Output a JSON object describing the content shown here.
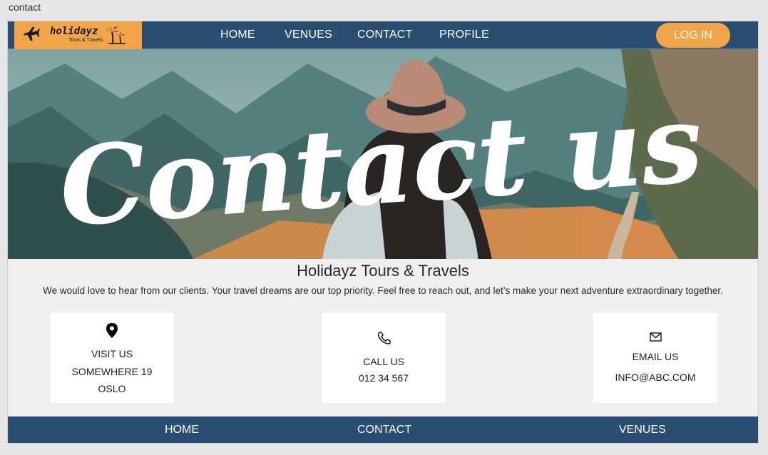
{
  "page_label": "contact",
  "header": {
    "logo_title": "holidayz",
    "logo_subtitle": "Tours & Travels",
    "nav": [
      "HOME",
      "VENUES",
      "CONTACT",
      "PROFILE"
    ],
    "login_label": "LOG IN"
  },
  "hero": {
    "text": "Contact us"
  },
  "intro": {
    "title": "Holidayz Tours & Travels",
    "text": "We would love to hear from our clients. Your travel dreams are our top priority. Feel free to reach out, and let’s make your next adventure extraordinary together."
  },
  "cards": [
    {
      "icon": "location-pin-icon",
      "lines": [
        "VISIT US",
        "SOMEWHERE 19",
        "OSLO"
      ]
    },
    {
      "icon": "phone-icon",
      "lines": [
        "CALL US",
        "012 34 567"
      ]
    },
    {
      "icon": "envelope-icon",
      "lines": [
        "EMAIL US",
        "INFO@ABC.COM"
      ]
    }
  ],
  "footer": {
    "nav": [
      "HOME",
      "CONTACT",
      "VENUES"
    ]
  },
  "colors": {
    "navy": "#2a4d72",
    "orange": "#f2a548",
    "background": "#efefef"
  }
}
